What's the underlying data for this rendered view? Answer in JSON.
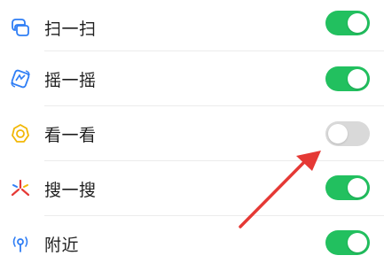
{
  "settings": {
    "items": [
      {
        "label": "扫一扫",
        "icon": "scan-icon",
        "enabled": true
      },
      {
        "label": "摇一摇",
        "icon": "shake-icon",
        "enabled": true
      },
      {
        "label": "看一看",
        "icon": "look-icon",
        "enabled": false
      },
      {
        "label": "搜一搜",
        "icon": "search-sparkle-icon",
        "enabled": true
      },
      {
        "label": "附近",
        "icon": "nearby-icon",
        "enabled": true
      }
    ]
  },
  "colors": {
    "toggle_on": "#22c05f",
    "toggle_off": "#d9d9d9",
    "arrow": "#e53935",
    "icon_blue": "#2f7ef5",
    "icon_yellow": "#f2b705",
    "icon_red": "#e53935"
  },
  "annotation": {
    "arrow_icon": "red-pointer-arrow-icon",
    "target": "看一看"
  }
}
